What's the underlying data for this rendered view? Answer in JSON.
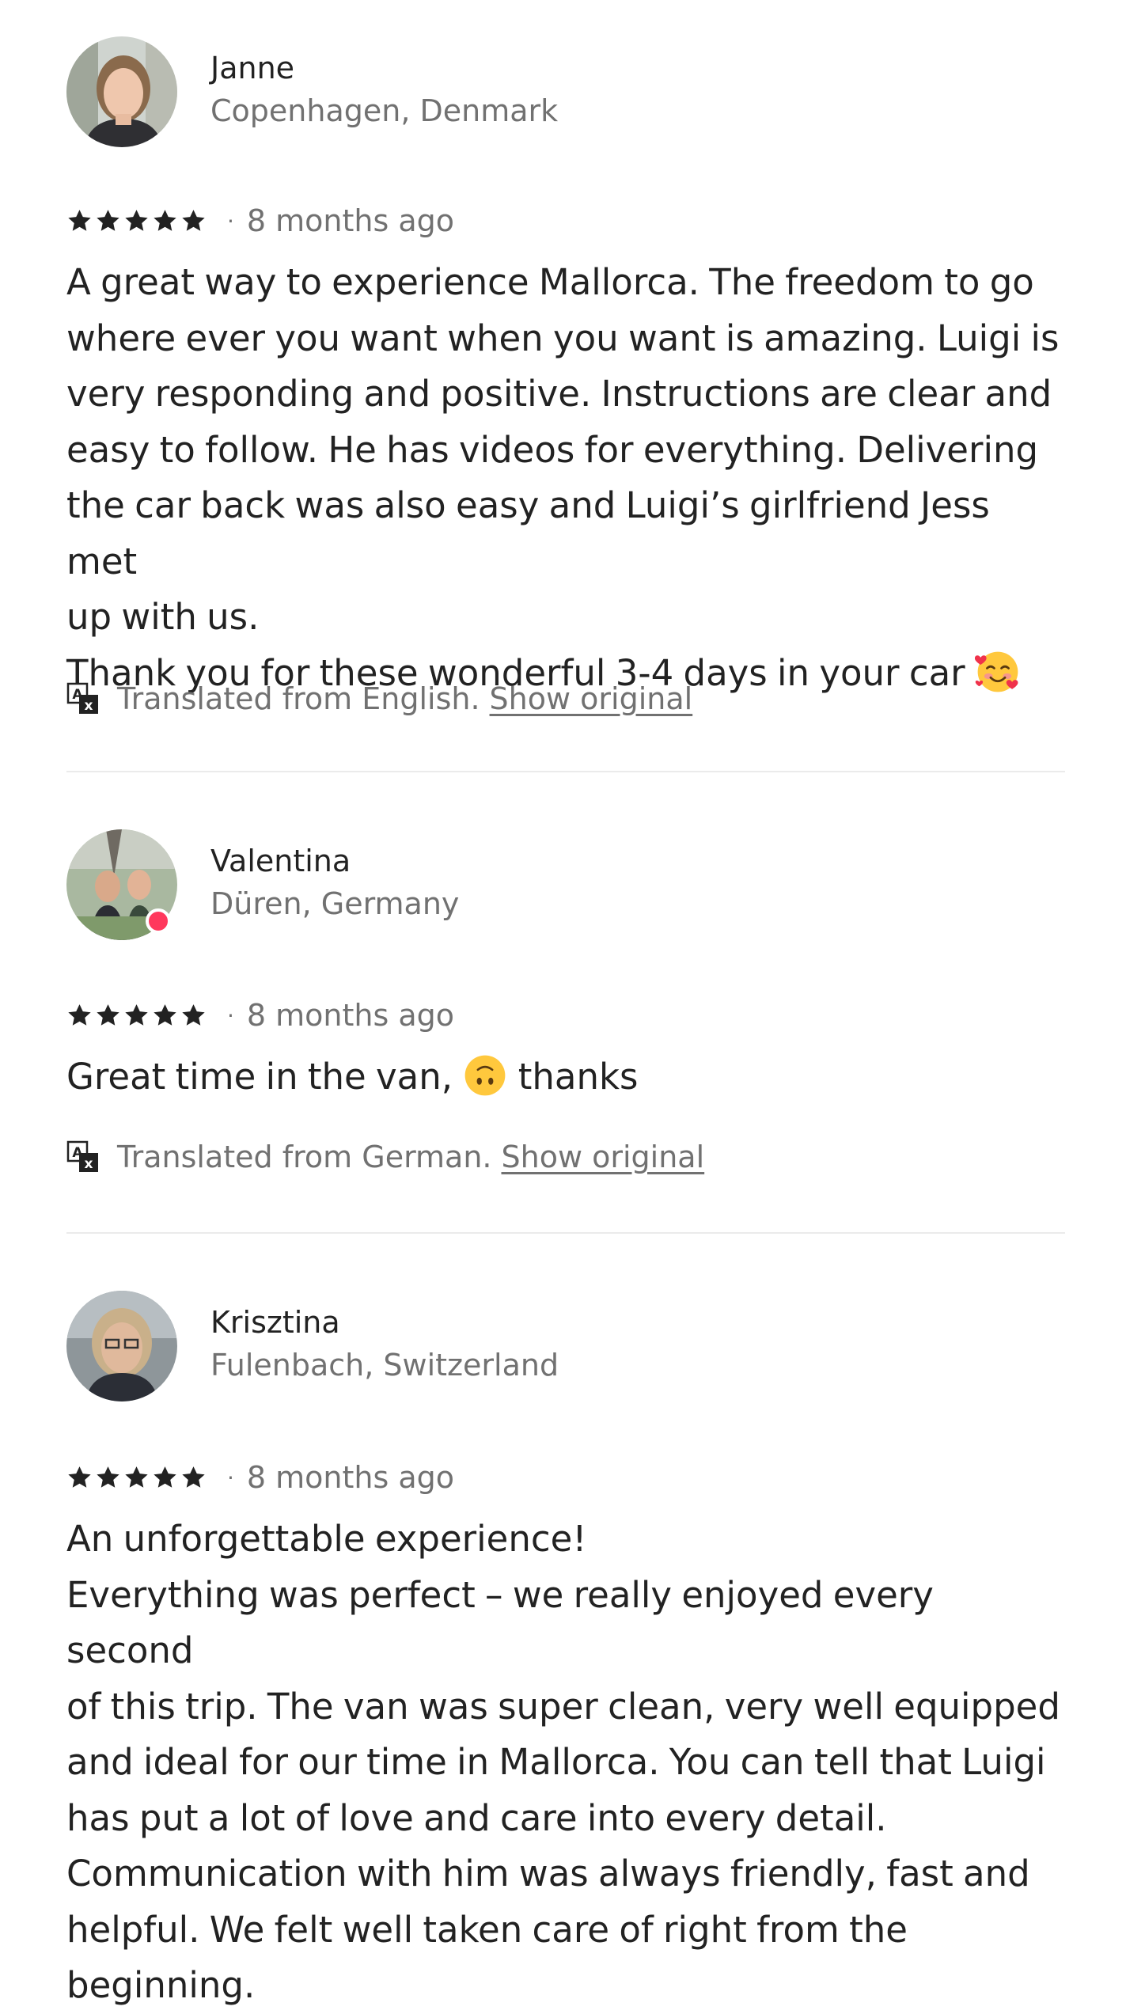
{
  "reviews": [
    {
      "name": "Janne",
      "location": "Copenhagen, Denmark",
      "rating": 5,
      "date": "8 months ago",
      "text_lines": [
        "A great way to experience Mallorca. The freedom to go",
        "where ever you want when you want is amazing. Luigi is",
        "very responding and positive. Instructions are clear and",
        "easy to follow. He has videos for everything. Delivering",
        "the car back was also easy and Luigi’s girlfriend Jess met",
        "up with us.",
        "Thank you for these wonderful 3-4 days in your car"
      ],
      "emoji": "smiling-face-with-hearts",
      "translation_note": "Translated from English.",
      "show_original_label": "Show original"
    },
    {
      "name": "Valentina",
      "location": "Düren, Germany",
      "rating": 5,
      "date": "8 months ago",
      "text_before_emoji": "Great time in the van,",
      "emoji": "upside-down-face",
      "text_after_emoji": "thanks",
      "translation_note": "Translated from German.",
      "show_original_label": "Show original"
    },
    {
      "name": "Krisztina",
      "location": "Fulenbach, Switzerland",
      "rating": 5,
      "date": "8 months ago",
      "text_lines": [
        "An unforgettable experience!",
        "Everything was perfect – we really enjoyed every second",
        "of this trip. The van was super clean, very well equipped",
        "and ideal for our time in Mallorca. You can tell that Luigi",
        "has put a lot of love and care into every detail.",
        "Communication with him was always friendly, fast and",
        "helpful. We felt well taken care of right from the",
        "beginning."
      ]
    }
  ],
  "separator_dot": "·",
  "icons": {
    "star": "star-icon",
    "translate": "translate-icon"
  },
  "colors": {
    "primary_text": "#222222",
    "secondary_text": "#717171",
    "divider": "#ebebeb",
    "badge": "#ff385c"
  }
}
